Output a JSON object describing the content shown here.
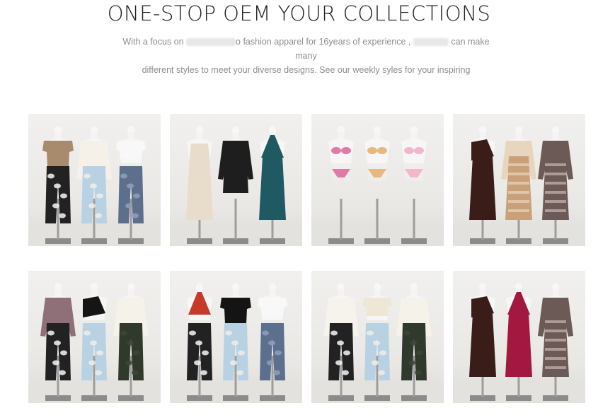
{
  "header": {
    "title": "ONE-STOP OEM YOUR COLLECTIONS",
    "subtitle_part1": "With a focus on",
    "subtitle_part2": "o fashion apparel for 16years of experience ,",
    "subtitle_part3": "can make many",
    "subtitle_line2": "different styles to meet your diverse designs. See our weekly syles for your inspiring"
  },
  "gallery": {
    "items": [
      {
        "name": "photo-knit-top-cow-print-pants-set",
        "mannequins": [
          {
            "top": "#a88a6c",
            "topType": "short",
            "bottom": "#222222",
            "bottomType": "pants",
            "bottom2": "#f4f4f4"
          },
          {
            "top": "#f5f1e8",
            "topType": "long",
            "bottom": "#b9d2e3",
            "bottomType": "pants",
            "bottom2": "#f0ede6"
          },
          {
            "top": "#f8f8f8",
            "topType": "crop",
            "bottom": "#5c6f8c",
            "bottomType": "pants",
            "bottom2": "#8ea0bb"
          }
        ]
      },
      {
        "name": "photo-dresses-set",
        "mannequins": [
          {
            "top": "#e8dccb",
            "topType": "slip",
            "bottom": "#e8dccb",
            "bottomType": "dress",
            "bottom2": "#e8dccb"
          },
          {
            "top": "#1e1e1e",
            "topType": "long",
            "bottom": "#1e1e1e",
            "bottomType": "shortdress",
            "bottom2": "#1e1e1e"
          },
          {
            "top": "#1f5962",
            "topType": "halter",
            "bottom": "#1f5962",
            "bottomType": "dress",
            "bottom2": "#1f5962"
          }
        ]
      },
      {
        "name": "photo-bikini-set",
        "mannequins": [
          {
            "top": "#d8528d",
            "topType": "bikini",
            "bottom": "#d8528d",
            "bottomType": "bikini",
            "bottom2": "#d8528d"
          },
          {
            "top": "#e2a556",
            "topType": "bikini",
            "bottom": "#e2a556",
            "bottomType": "bikini",
            "bottom2": "#e2a556"
          },
          {
            "top": "#f0a0c0",
            "topType": "bikini",
            "bottom": "#f0a0c0",
            "bottomType": "bikini",
            "bottom2": "#f0a0c0"
          }
        ]
      },
      {
        "name": "photo-cutout-dress-set",
        "mannequins": [
          {
            "top": "#3a1d18",
            "topType": "oneshoulder",
            "bottom": "#3a1d18",
            "bottomType": "dress",
            "bottom2": "#3a1d18"
          },
          {
            "top": "#e8d5be",
            "topType": "long",
            "bottom": "#c9a07a",
            "bottomType": "dress",
            "bottom2": "#e8d5be"
          },
          {
            "top": "#6b5a55",
            "topType": "long",
            "bottom": "#6b5a55",
            "bottomType": "dress",
            "bottom2": "#c7b8b0"
          }
        ]
      },
      {
        "name": "photo-mixed-tops-pants-set",
        "mannequins": [
          {
            "top": "#8f6f78",
            "topType": "long",
            "bottom": "#222222",
            "bottomType": "pants",
            "bottom2": "#f4f4f4"
          },
          {
            "top": "#151515",
            "topType": "oneshoulder",
            "bottom": "#b9d2e3",
            "bottomType": "pants",
            "bottom2": "#f0ede6"
          },
          {
            "top": "#f5f2ea",
            "topType": "long",
            "bottom": "#2f3a2c",
            "bottomType": "pants",
            "bottom2": "#3b4636"
          }
        ]
      },
      {
        "name": "photo-halter-tee-pants-set",
        "mannequins": [
          {
            "top": "#c63a2a",
            "topType": "halter",
            "bottom": "#222222",
            "bottomType": "pants",
            "bottom2": "#f4f4f4"
          },
          {
            "top": "#141414",
            "topType": "short",
            "bottom": "#b9d2e3",
            "bottomType": "pants",
            "bottom2": "#f0ede6"
          },
          {
            "top": "#f8f8f8",
            "topType": "crop",
            "bottom": "#5c6f8c",
            "bottomType": "pants",
            "bottom2": "#8ea0bb"
          }
        ]
      },
      {
        "name": "photo-white-tops-pants-set",
        "mannequins": [
          {
            "top": "#f6f3ec",
            "topType": "long",
            "bottom": "#222222",
            "bottomType": "pants",
            "bottom2": "#f4f4f4"
          },
          {
            "top": "#efe7d6",
            "topType": "crop",
            "bottom": "#b9d2e3",
            "bottomType": "pants",
            "bottom2": "#f0ede6"
          },
          {
            "top": "#f5f2ea",
            "topType": "long",
            "bottom": "#2f3a2c",
            "bottomType": "pants",
            "bottom2": "#3b4636"
          }
        ]
      },
      {
        "name": "photo-red-cutout-dress-set",
        "mannequins": [
          {
            "top": "#3a1d18",
            "topType": "oneshoulder",
            "bottom": "#3a1d18",
            "bottomType": "dress",
            "bottom2": "#3a1d18"
          },
          {
            "top": "#a3183e",
            "topType": "halter",
            "bottom": "#a3183e",
            "bottomType": "dress",
            "bottom2": "#a3183e"
          },
          {
            "top": "#6b5a55",
            "topType": "long",
            "bottom": "#6b5a55",
            "bottomType": "dress",
            "bottom2": "#c7b8b0"
          }
        ]
      }
    ]
  }
}
